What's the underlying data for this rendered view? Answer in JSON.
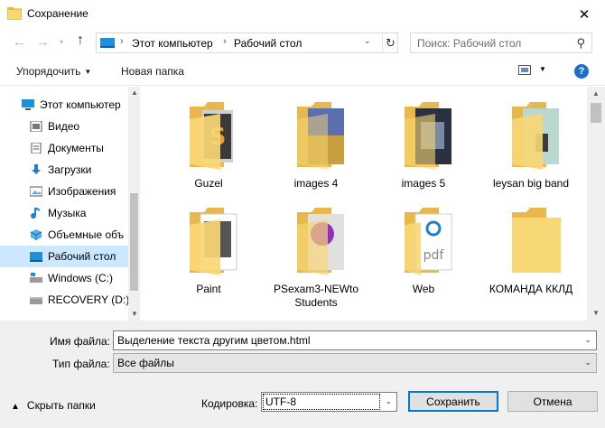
{
  "window": {
    "title": "Сохранение"
  },
  "address": {
    "segments": [
      "Этот компьютер",
      "Рабочий стол"
    ]
  },
  "search": {
    "placeholder": "Поиск: Рабочий стол"
  },
  "toolbar": {
    "organize_label": "Упорядочить",
    "new_folder_label": "Новая папка",
    "help_label": "?"
  },
  "nav": {
    "items": [
      {
        "label": "Этот компьютер",
        "icon": "computer-icon"
      },
      {
        "label": "Видео",
        "icon": "video-icon"
      },
      {
        "label": "Документы",
        "icon": "documents-icon"
      },
      {
        "label": "Загрузки",
        "icon": "downloads-icon"
      },
      {
        "label": "Изображения",
        "icon": "pictures-icon"
      },
      {
        "label": "Музыка",
        "icon": "music-icon"
      },
      {
        "label": "Объемные объ",
        "icon": "3d-objects-icon"
      },
      {
        "label": "Рабочий стол",
        "icon": "desktop-icon",
        "selected": true
      },
      {
        "label": "Windows (C:)",
        "icon": "drive-icon"
      },
      {
        "label": "RECOVERY (D:)",
        "icon": "drive-icon"
      }
    ]
  },
  "files": [
    {
      "name": "Guzel",
      "thumb": "guzel"
    },
    {
      "name": "images 4",
      "thumb": "images4"
    },
    {
      "name": "images 5",
      "thumb": "images5"
    },
    {
      "name": "leysan big band",
      "thumb": "leysan"
    },
    {
      "name": "Paint",
      "thumb": "paint"
    },
    {
      "name": "PSexam3-NEWto Students",
      "thumb": "psexam"
    },
    {
      "name": "Web",
      "thumb": "web"
    },
    {
      "name": "КОМАНДА ККЛД",
      "thumb": "empty"
    }
  ],
  "form": {
    "filename_label": "Имя файла:",
    "filename_value": "Выделение текста другим цветом.html",
    "filetype_label": "Тип файла:",
    "filetype_value": "Все файлы",
    "hide_folders_label": "Скрыть папки",
    "encoding_label": "Кодировка:",
    "encoding_value": "UTF-8",
    "save_label": "Сохранить",
    "cancel_label": "Отмена"
  },
  "colors": {
    "accent": "#0078d7",
    "selected_bg": "#cce8ff",
    "folder": "#f8d775"
  }
}
